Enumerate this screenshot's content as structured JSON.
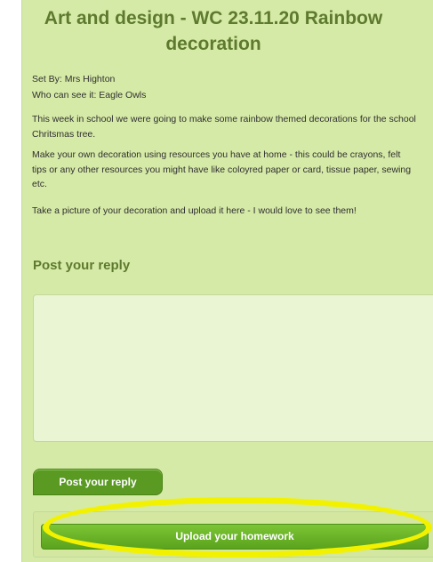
{
  "assignment": {
    "title": "Art and design - WC 23.11.20 Rainbow decoration",
    "set_by": "Set By: Mrs Highton",
    "who_can_see": "Who can see it: Eagle Owls",
    "paragraphs": [
      "This week in school we were going to make some rainbow themed decorations for the school Chritsmas tree.",
      "Make your own decoration using resources you have at home - this could be crayons, felt tips or any other resources you might have like coloyred paper or card, tissue paper, sewing etc.",
      "Take a picture of your decoration and upload it here - I would love to see them!"
    ]
  },
  "reply": {
    "heading": "Post your reply",
    "textarea_value": "",
    "post_button_label": "Post your reply"
  },
  "upload": {
    "button_label": "Upload your homework"
  },
  "colors": {
    "panel_bg": "#d6eaa7",
    "heading_green": "#5d7a2e",
    "button_green": "#5a9a23",
    "highlight_yellow": "#f2f200"
  }
}
